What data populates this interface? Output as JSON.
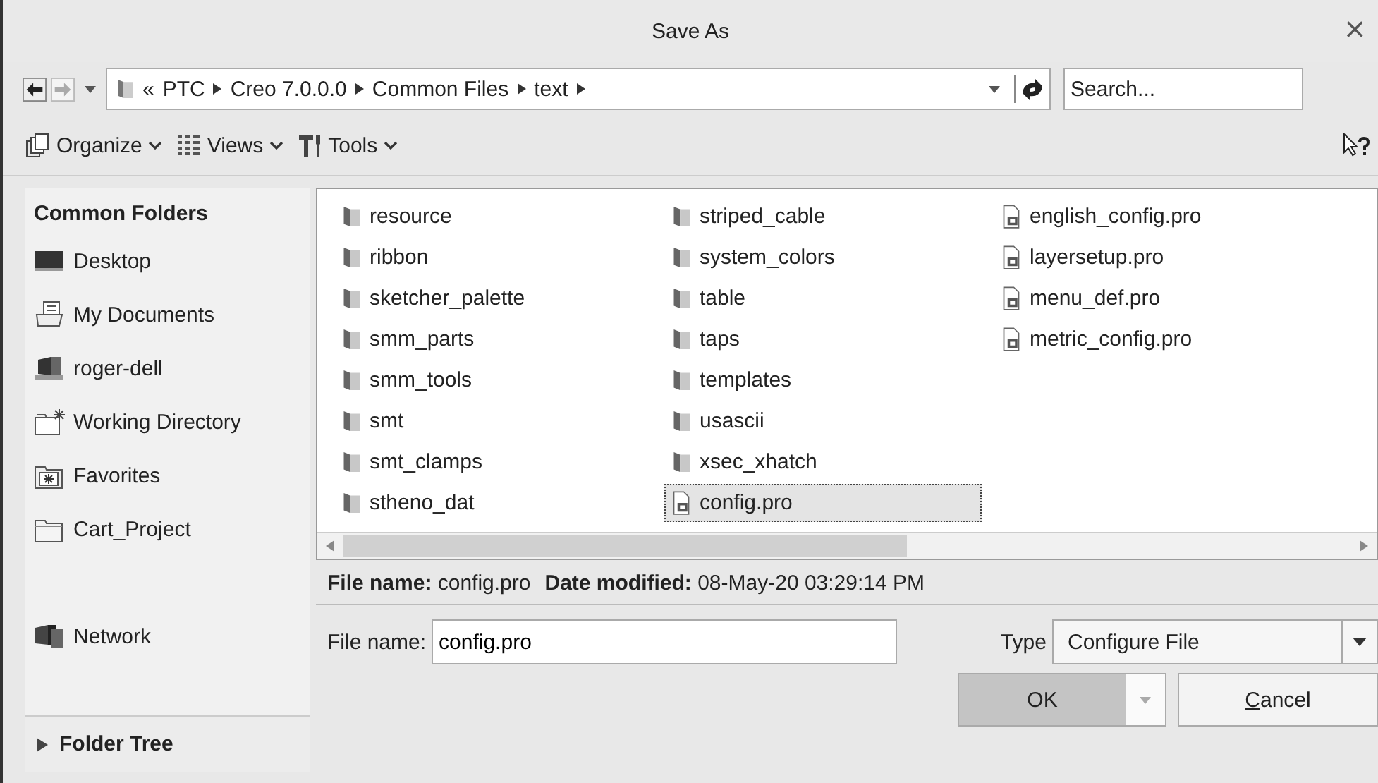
{
  "window": {
    "title": "Save As",
    "close": "×"
  },
  "address": {
    "prefix": "«",
    "segments": [
      "PTC",
      "Creo 7.0.0.0",
      "Common Files",
      "text"
    ]
  },
  "search": {
    "placeholder": "Search..."
  },
  "toolbar": [
    "Organize",
    "Views",
    "Tools"
  ],
  "sidebar": {
    "heading": "Common Folders",
    "items": [
      {
        "label": "Desktop",
        "kind": "desktop"
      },
      {
        "label": "My Documents",
        "kind": "documents"
      },
      {
        "label": "roger-dell",
        "kind": "computer"
      },
      {
        "label": "Working Directory",
        "kind": "working"
      },
      {
        "label": "Favorites",
        "kind": "favorites"
      },
      {
        "label": "Cart_Project",
        "kind": "folder"
      }
    ],
    "network": {
      "label": "Network",
      "kind": "network"
    },
    "folder_tree": {
      "label": "Folder Tree",
      "expanded": false
    }
  },
  "files": [
    {
      "name": "resource",
      "kind": "folder",
      "selected": false
    },
    {
      "name": "ribbon",
      "kind": "folder",
      "selected": false
    },
    {
      "name": "sketcher_palette",
      "kind": "folder",
      "selected": false
    },
    {
      "name": "smm_parts",
      "kind": "folder",
      "selected": false
    },
    {
      "name": "smm_tools",
      "kind": "folder",
      "selected": false
    },
    {
      "name": "smt",
      "kind": "folder",
      "selected": false
    },
    {
      "name": "smt_clamps",
      "kind": "folder",
      "selected": false
    },
    {
      "name": "stheno_dat",
      "kind": "folder",
      "selected": false
    },
    {
      "name": "striped_cable",
      "kind": "folder",
      "selected": false
    },
    {
      "name": "system_colors",
      "kind": "folder",
      "selected": false
    },
    {
      "name": "table",
      "kind": "folder",
      "selected": false
    },
    {
      "name": "taps",
      "kind": "folder",
      "selected": false
    },
    {
      "name": "templates",
      "kind": "folder",
      "selected": false
    },
    {
      "name": "usascii",
      "kind": "folder",
      "selected": false
    },
    {
      "name": "xsec_xhatch",
      "kind": "folder",
      "selected": false
    },
    {
      "name": "config.pro",
      "kind": "file",
      "selected": true
    },
    {
      "name": "english_config.pro",
      "kind": "file",
      "selected": false
    },
    {
      "name": "layersetup.pro",
      "kind": "file",
      "selected": false
    },
    {
      "name": "menu_def.pro",
      "kind": "file",
      "selected": false
    },
    {
      "name": "metric_config.pro",
      "kind": "file",
      "selected": false
    }
  ],
  "details": [
    {
      "label": "File name:",
      "value": "config.pro"
    },
    {
      "label": "Date modified:",
      "value": "08-May-20 03:29:14 PM"
    }
  ],
  "file_name": {
    "label": "File name:",
    "value": "config.pro"
  },
  "type": {
    "label": "Type",
    "value": "Configure File"
  },
  "buttons": {
    "ok": "OK",
    "cancel": "Cancel"
  }
}
